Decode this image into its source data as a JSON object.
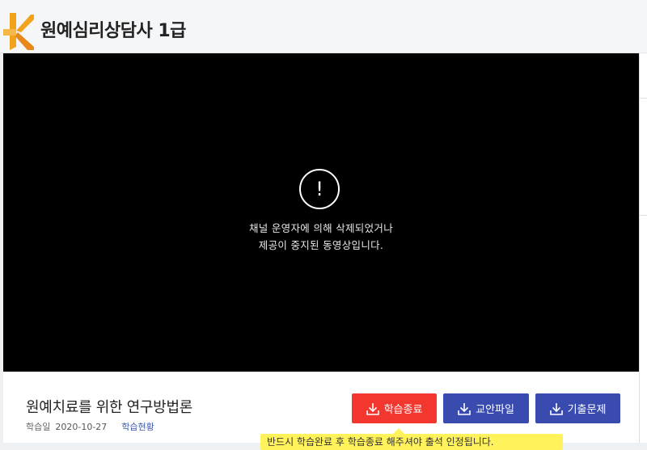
{
  "header": {
    "title": "원예심리상담사 1급"
  },
  "video": {
    "message_line1": "채널 운영자에 의해 삭제되었거나",
    "message_line2": "제공이 중지된 동영상입니다.",
    "alert_symbol": "!"
  },
  "lecture": {
    "title": "원예치료를 위한 연구방법론",
    "date_label": "학습일",
    "date_value": "2020-10-27",
    "status_link": "학습현황"
  },
  "buttons": {
    "finish": "학습종료",
    "materials": "교안파일",
    "past_exams": "기출문제"
  },
  "tooltip": {
    "text": "반드시 학습완료 후 학습종료 해주셔야 출석 인정됩니다."
  },
  "colors": {
    "finish_button": "#f3372e",
    "download_buttons": "#3a4bb0",
    "tooltip": "#fff25a",
    "logo_primary": "#f2a31b"
  },
  "icons": {
    "logo": "k-logo-icon",
    "alert": "exclamation-circle-icon",
    "download": "download-icon"
  }
}
